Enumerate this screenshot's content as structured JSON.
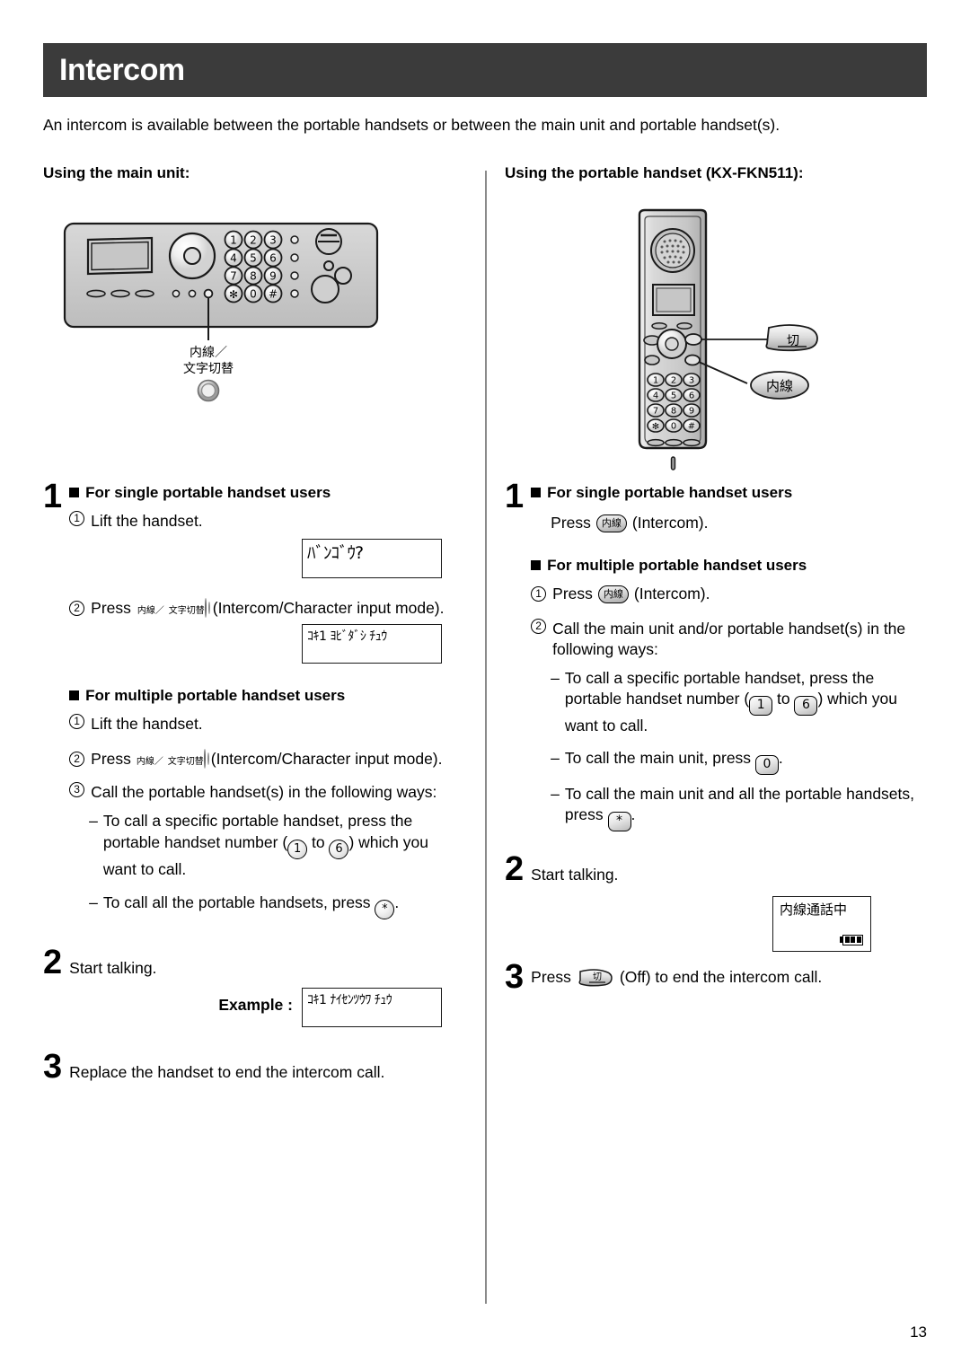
{
  "header": {
    "title": "Intercom"
  },
  "intro": "An intercom is available between the portable handsets or between the main unit and portable handset(s).",
  "footer": {
    "page_number": "13"
  },
  "left_column": {
    "heading": "Using the main unit:",
    "figure": {
      "name": "main-unit-control-panel",
      "callout_label_line1": "内線／",
      "callout_label_line2": "文字切替",
      "keypad": [
        "1",
        "2",
        "3",
        "4",
        "5",
        "6",
        "7",
        "8",
        "9",
        "*",
        "0",
        "#"
      ]
    },
    "step1": {
      "number": "1",
      "single": {
        "heading": "For single portable handset users",
        "items": [
          {
            "marker": "1",
            "text": "Lift the handset."
          },
          {
            "marker": "2",
            "text_before": "Press",
            "button_label_top": "内線／",
            "button_label_bottom": "文字切替",
            "text_after": "(Intercom/Character input mode)."
          }
        ],
        "lcd_after_item1": "ﾊﾞﾝｺﾞｳ?",
        "lcd_after_item2": "ｺｷ1 ﾖﾋﾞﾀﾞｼ ﾁｭｳ"
      },
      "multiple": {
        "heading": "For multiple portable handset users",
        "items": [
          {
            "marker": "1",
            "text": "Lift the handset."
          },
          {
            "marker": "2",
            "text_before": "Press",
            "button_label_top": "内線／",
            "button_label_bottom": "文字切替",
            "text_after": "(Intercom/Character input mode)."
          },
          {
            "marker": "3",
            "text": "Call the portable handset(s) in the following ways:"
          }
        ],
        "bullets": [
          {
            "dash": "–",
            "part1": "To call a specific portable handset, press the portable handset number (",
            "key1": "1",
            "mid": " to ",
            "key2": "6",
            "part2": ") which you want to call."
          },
          {
            "dash": "–",
            "part1": "To call all the portable handsets, press ",
            "key1": "*",
            "part2": "."
          }
        ]
      }
    },
    "step2": {
      "number": "2",
      "text": "Start talking.",
      "example_label": "Example :",
      "example_lcd": "ｺｷ1 ﾅｲｾﾝﾂｳﾜ ﾁｭｳ"
    },
    "step3": {
      "number": "3",
      "text": "Replace the handset to end the intercom call."
    }
  },
  "right_column": {
    "heading": "Using the portable handset (KX-FKN511):",
    "figure": {
      "name": "portable-handset",
      "callout_off": "切",
      "callout_intercom": "内線",
      "keypad": [
        "1",
        "2",
        "3",
        "4",
        "5",
        "6",
        "7",
        "8",
        "9",
        "*",
        "0",
        "#"
      ]
    },
    "step1": {
      "number": "1",
      "single": {
        "heading": "For single portable handset users",
        "text_before": "Press",
        "key": "内線",
        "text_after": "(Intercom)."
      },
      "multiple": {
        "heading": "For multiple portable handset users",
        "items": [
          {
            "marker": "1",
            "text_before": "Press",
            "key": "内線",
            "text_after": "(Intercom)."
          },
          {
            "marker": "2",
            "text": "Call the main unit and/or portable handset(s) in the following ways:"
          }
        ],
        "bullets": [
          {
            "dash": "–",
            "part1": "To call a specific portable handset, press the portable handset number (",
            "key1": "1",
            "mid": " to ",
            "key2": "6",
            "part2": ") which you want to call."
          },
          {
            "dash": "–",
            "part1": "To call the main unit, press ",
            "key1": "0",
            "part2": "."
          },
          {
            "dash": "–",
            "part1": "To call the main unit and all the portable handsets, press ",
            "key1": "*",
            "part2": "."
          }
        ]
      }
    },
    "step2": {
      "number": "2",
      "text": "Start talking.",
      "lcd_text": "内線通話中",
      "lcd_battery_bars": 3
    },
    "step3": {
      "number": "3",
      "text_before": "Press",
      "key": "切",
      "text_after": "(Off) to end the intercom call."
    }
  }
}
